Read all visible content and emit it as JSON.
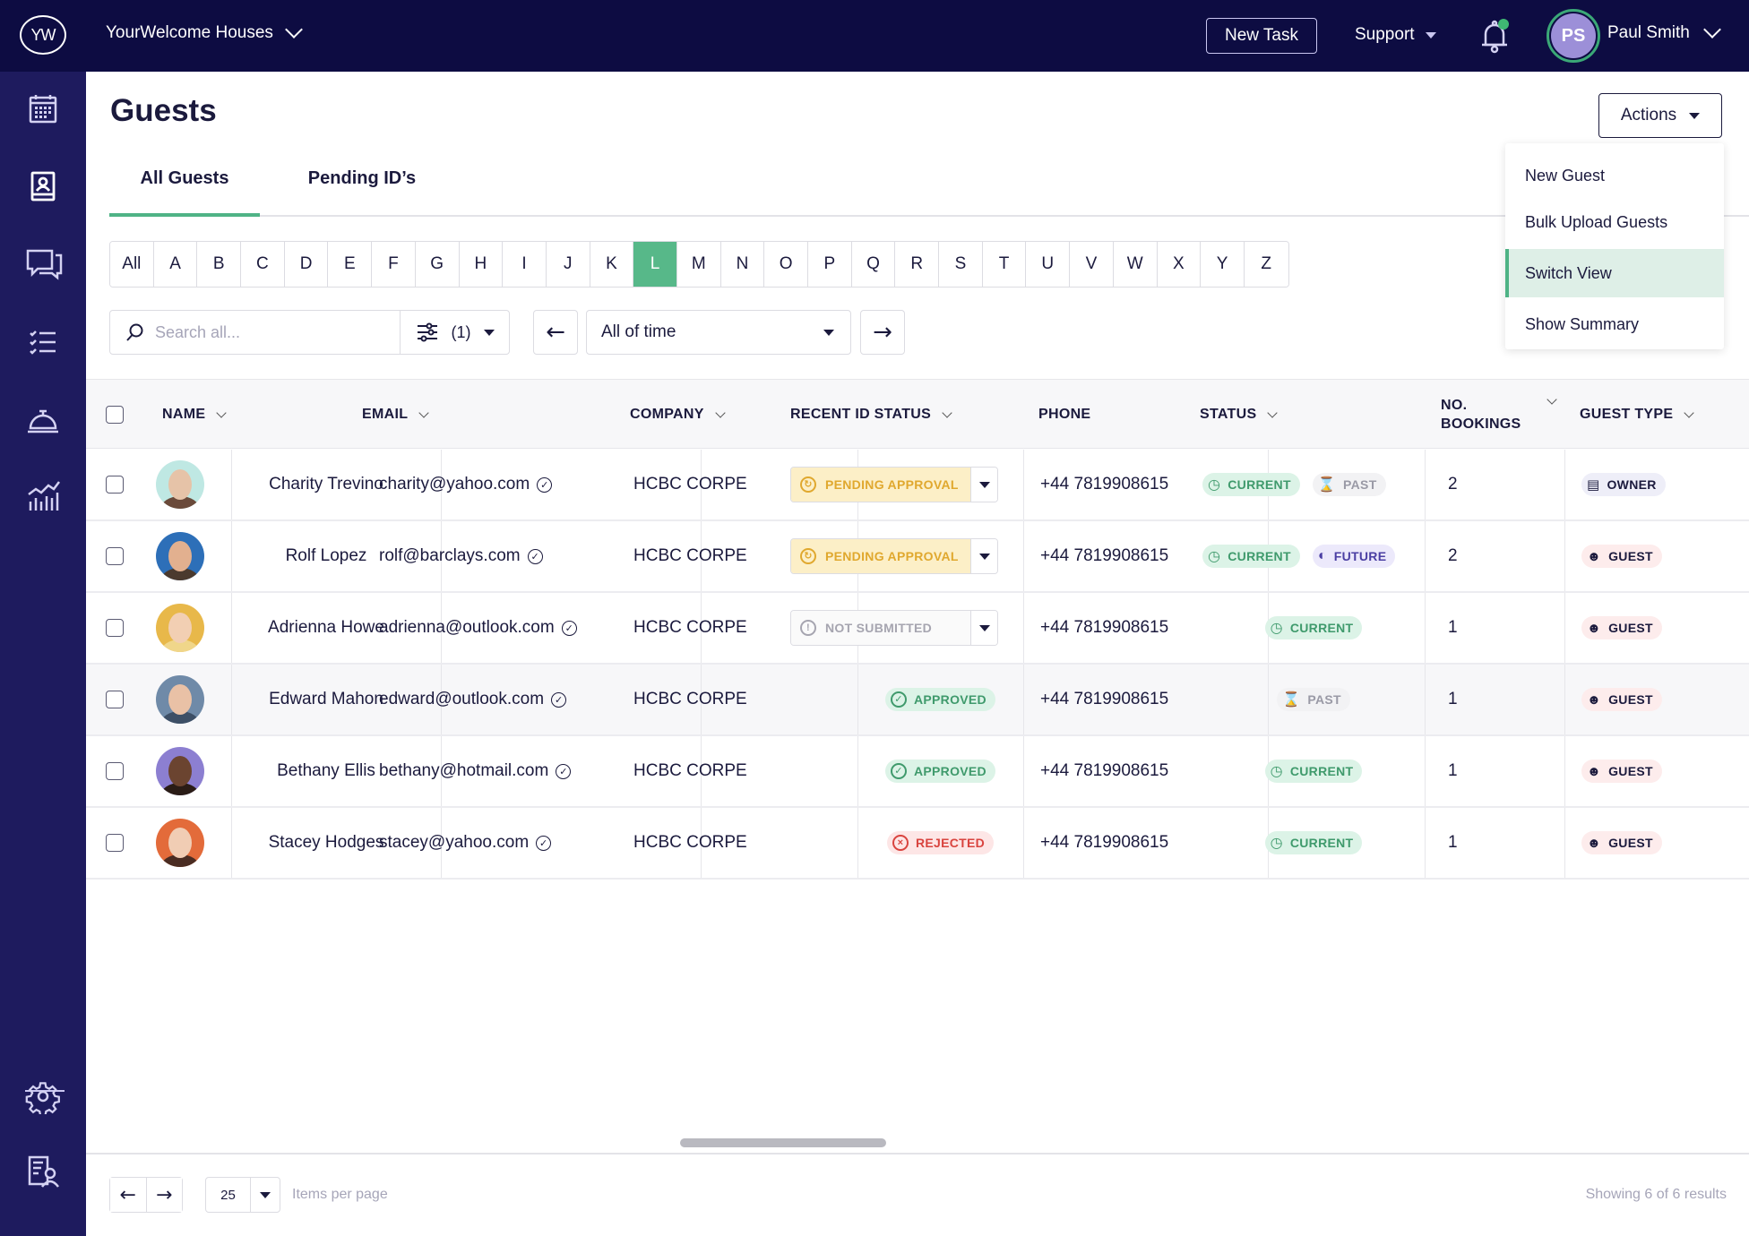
{
  "topbar": {
    "logo_text": "YW",
    "org_name": "YourWelcome Houses",
    "new_task_label": "New Task",
    "support_label": "Support",
    "notification_dot_color": "#3fb873",
    "user_initials": "PS",
    "user_name": "Paul Smith"
  },
  "sidebar": {
    "items": [
      {
        "icon": "calendar-icon"
      },
      {
        "icon": "guest-book-icon"
      },
      {
        "icon": "chat-icon"
      },
      {
        "icon": "checklist-icon"
      },
      {
        "icon": "service-bell-icon"
      },
      {
        "icon": "analytics-icon"
      }
    ],
    "bottom_items": [
      {
        "icon": "gear-icon"
      },
      {
        "icon": "user-report-icon"
      }
    ]
  },
  "page": {
    "title": "Guests",
    "actions_label": "Actions",
    "tabs": [
      {
        "label": "All Guests",
        "active": true
      },
      {
        "label": "Pending ID’s",
        "active": false
      }
    ]
  },
  "actions_menu": {
    "items": [
      {
        "label": "New Guest",
        "highlighted": false
      },
      {
        "label": "Bulk Upload Guests",
        "highlighted": false
      },
      {
        "label": "Switch View",
        "highlighted": true
      },
      {
        "label": "Show Summary",
        "highlighted": false
      }
    ]
  },
  "alphabet": {
    "letters": [
      "All",
      "A",
      "B",
      "C",
      "D",
      "E",
      "F",
      "G",
      "H",
      "I",
      "J",
      "K",
      "L",
      "M",
      "N",
      "O",
      "P",
      "Q",
      "R",
      "S",
      "T",
      "U",
      "V",
      "W",
      "X",
      "Y",
      "Z"
    ],
    "selected": "L"
  },
  "filters": {
    "search_placeholder": "Search all...",
    "search_value": "",
    "filter_count": "(1)",
    "time_range": "All of time"
  },
  "table": {
    "columns": {
      "name": "NAME",
      "email": "EMAIL",
      "company": "COMPANY",
      "id_status": "RECENT ID STATUS",
      "phone": "PHONE",
      "status": "STATUS",
      "bookings_line1": "NO.",
      "bookings_line2": "BOOKINGS",
      "guest_type": "GUEST TYPE"
    },
    "rows": [
      {
        "name": "Charity Trevino",
        "email": "charity@yahoo.com",
        "company": "HCBC CORPE",
        "id_status": "PENDING APPROVAL",
        "id_status_kind": "pending",
        "phone": "+44 7819908615",
        "statuses": [
          "CURRENT",
          "PAST"
        ],
        "bookings": "2",
        "guest_type": "OWNER"
      },
      {
        "name": "Rolf Lopez",
        "email": "rolf@barclays.com",
        "company": "HCBC CORPE",
        "id_status": "PENDING APPROVAL",
        "id_status_kind": "pending",
        "phone": "+44 7819908615",
        "statuses": [
          "CURRENT",
          "FUTURE"
        ],
        "bookings": "2",
        "guest_type": "GUEST"
      },
      {
        "name": "Adrienna Howe",
        "email": "adrienna@outlook.com",
        "company": "HCBC CORPE",
        "id_status": "NOT SUBMITTED",
        "id_status_kind": "not_submitted",
        "phone": "+44 7819908615",
        "statuses": [
          "CURRENT"
        ],
        "bookings": "1",
        "guest_type": "GUEST"
      },
      {
        "name": "Edward Mahon",
        "email": "edward@outlook.com",
        "company": "HCBC CORPE",
        "id_status": "APPROVED",
        "id_status_kind": "approved",
        "phone": "+44 7819908615",
        "statuses": [
          "PAST"
        ],
        "bookings": "1",
        "guest_type": "GUEST"
      },
      {
        "name": "Bethany Ellis",
        "email": "bethany@hotmail.com",
        "company": "HCBC CORPE",
        "id_status": "APPROVED",
        "id_status_kind": "approved",
        "phone": "+44 7819908615",
        "statuses": [
          "CURRENT"
        ],
        "bookings": "1",
        "guest_type": "GUEST"
      },
      {
        "name": "Stacey Hodges",
        "email": "stacey@yahoo.com",
        "company": "HCBC CORPE",
        "id_status": "REJECTED",
        "id_status_kind": "rejected",
        "phone": "+44 7819908615",
        "statuses": [
          "CURRENT"
        ],
        "bookings": "1",
        "guest_type": "GUEST"
      }
    ]
  },
  "footer": {
    "per_page": "25",
    "items_per_page_label": "Items per page",
    "showing_text": "Showing 6 of 6 results"
  },
  "colors": {
    "navy": "#0d0c42",
    "sidebar": "#1e1b5e",
    "accent_green": "#57b889",
    "pending_bg": "#fcefc7",
    "pending_fg": "#e0a82e",
    "approved_bg": "#dcf3e7",
    "approved_fg": "#3f9a6c",
    "rejected_bg": "#fde6e6",
    "rejected_fg": "#d9443f",
    "future_bg": "#ece9fb",
    "future_fg": "#4b3fa3",
    "guest_bg": "#fdecec",
    "owner_bg": "#eeeef8"
  }
}
